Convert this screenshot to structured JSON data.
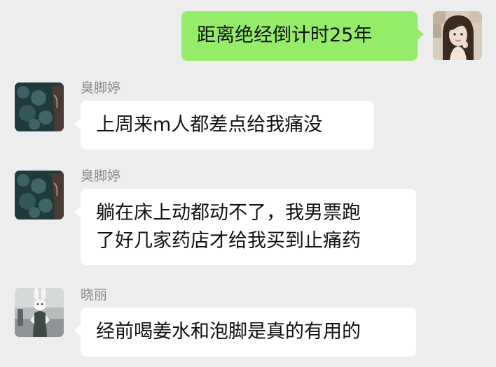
{
  "colors": {
    "background": "#ededed",
    "bubble_self": "#95ec69",
    "bubble_other": "#ffffff",
    "name_text": "#8a8a8a",
    "message_text": "#111111"
  },
  "messages": [
    {
      "sender": "",
      "side": "right",
      "avatar_icon": "woman-portrait-avatar",
      "lines": [
        "距离绝经倒计时25年"
      ]
    },
    {
      "sender": "臭脚婷",
      "side": "left",
      "avatar_icon": "dark-teal-texture-avatar",
      "lines": [
        "上周来m人都差点给我痛没"
      ]
    },
    {
      "sender": "臭脚婷",
      "side": "left",
      "avatar_icon": "dark-teal-texture-avatar",
      "lines": [
        "躺在床上动都动不了，我男票跑",
        "了好几家药店才给我买到止痛药"
      ]
    },
    {
      "sender": "晓丽",
      "side": "left",
      "avatar_icon": "rabbit-figure-avatar",
      "lines": [
        "经前喝姜水和泡脚是真的有用的"
      ]
    }
  ]
}
